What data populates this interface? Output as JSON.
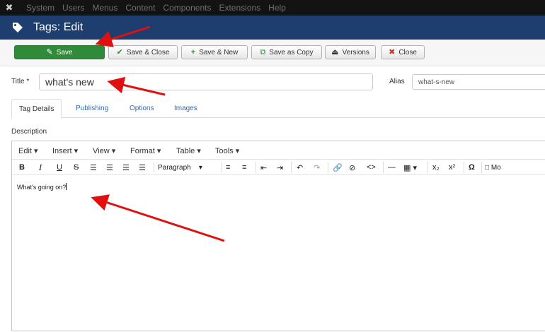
{
  "topmenu": {
    "logo_icon": "joomla-logo-icon",
    "items": [
      "System",
      "Users",
      "Menus",
      "Content",
      "Components",
      "Extensions",
      "Help"
    ]
  },
  "header": {
    "icon": "tag-icon",
    "title": "Tags: Edit"
  },
  "toolbar": {
    "save": {
      "label": "Save",
      "icon": "edit-icon"
    },
    "save_close": {
      "label": "Save & Close",
      "icon": "check-icon"
    },
    "save_new": {
      "label": "Save & New",
      "icon": "plus-icon"
    },
    "save_copy": {
      "label": "Save as Copy",
      "icon": "copy-icon"
    },
    "versions": {
      "label": "Versions",
      "icon": "eject-icon"
    },
    "close": {
      "label": "Close",
      "icon": "cancel-icon"
    }
  },
  "form": {
    "title_label": "Title",
    "title_required": "*",
    "title_value": "what's new",
    "alias_label": "Alias",
    "alias_value": "what-s-new"
  },
  "tabs": [
    "Tag Details",
    "Publishing",
    "Options",
    "Images"
  ],
  "active_tab": "Tag Details",
  "description_label": "Description",
  "editor": {
    "menus": [
      "Edit",
      "Insert",
      "View",
      "Format",
      "Table",
      "Tools"
    ],
    "paragraph_label": "Paragraph",
    "more_label": "Mo",
    "content": "What's going on?"
  },
  "colors": {
    "topbar": "#131313",
    "header": "#1d3e6e",
    "save_button": "#2f8a3a",
    "link": "#2a69b8",
    "annotation_arrow": "#e01010"
  }
}
